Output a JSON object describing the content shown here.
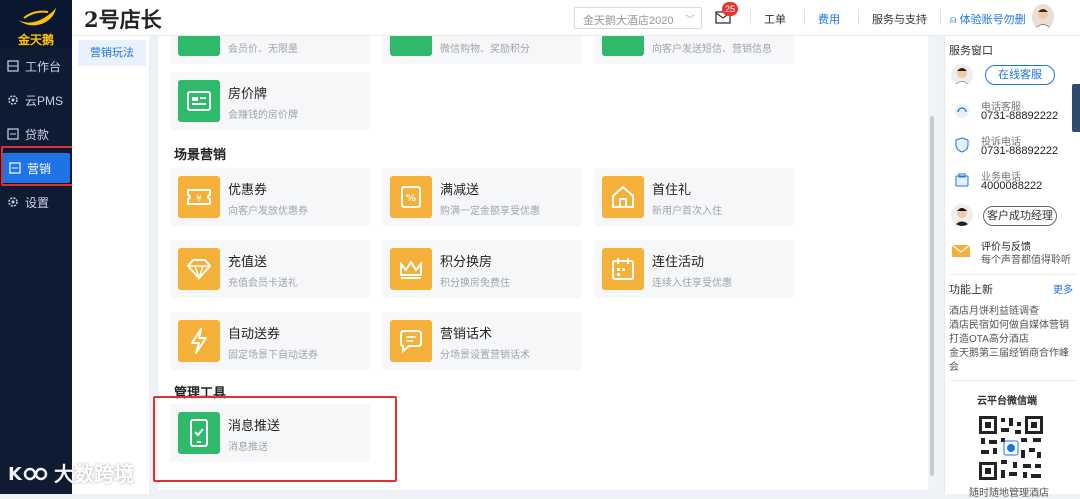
{
  "app": {
    "title": "2号店长",
    "brand": "金天鹅"
  },
  "left_nav": {
    "items": [
      {
        "label": "工作台",
        "icon": "workbench-icon"
      },
      {
        "label": "云PMS",
        "icon": "gear-icon"
      },
      {
        "label": "贷款",
        "icon": "loan-icon"
      },
      {
        "label": "营销",
        "icon": "marketing-icon",
        "active": true
      },
      {
        "label": "设置",
        "icon": "settings-icon"
      }
    ]
  },
  "header": {
    "hotel_select": "金天鹅大酒店2020",
    "mail_badge": "25",
    "links": [
      "工单",
      "费用",
      "服务与支持",
      "体验账号勿删"
    ]
  },
  "sub_nav": {
    "item": "营销玩法"
  },
  "main": {
    "top_partial_descs": [
      "会员价、无限量",
      "微信购物、奖励积分",
      "向客户发送短信、营销信息"
    ],
    "card_room_price": {
      "title": "房价牌",
      "desc": "会赚钱的房价牌"
    },
    "section_scene": "场景营销",
    "scene_cards": [
      {
        "title": "优惠券",
        "desc": "向客户发放优惠券",
        "icon": "coupon-icon"
      },
      {
        "title": "满减送",
        "desc": "购满一定金额享受优惠",
        "icon": "percent-discount-icon"
      },
      {
        "title": "首住礼",
        "desc": "新用户首次入住",
        "icon": "house-gift-icon"
      },
      {
        "title": "充值送",
        "desc": "充值会员卡送礼",
        "icon": "diamond-icon"
      },
      {
        "title": "积分换房",
        "desc": "积分换房免费住",
        "icon": "crown-icon"
      },
      {
        "title": "连住活动",
        "desc": "连续入住享受优惠",
        "icon": "calendar-icon"
      },
      {
        "title": "自动送券",
        "desc": "固定场景下自动送券",
        "icon": "lightning-icon"
      },
      {
        "title": "营销话术",
        "desc": "分场景设置营销话术",
        "icon": "chat-bubble-icon"
      }
    ],
    "section_mgmt": "管理工具",
    "mgmt_card": {
      "title": "消息推送",
      "desc": "消息推送",
      "icon": "phone-check-icon"
    }
  },
  "right_panel": {
    "service_title": "服务窗口",
    "online_service": "在线客服",
    "phone_label": "电话客服",
    "phone_value": "0731-88892222",
    "complaint_label": "投诉电话",
    "complaint_value": "0731-88892222",
    "business_label": "业务电话",
    "business_value": "4000088222",
    "success_manager": "客户成功经理",
    "feedback_title": "评价与反馈",
    "feedback_desc": "每个声音都值得聆听",
    "news_title": "功能上新",
    "news_more": "更多",
    "news": [
      "酒店月饼利益链调查",
      "酒店民宿如何做自媒体营销",
      "打造OTA高分酒店",
      "金天鹅第三届经销商合作峰",
      "会"
    ],
    "wechat_title": "云平台微信端",
    "wechat_desc": "随时随地管理酒店"
  },
  "watermark": "大数跨境",
  "colors": {
    "nav_bg": "#0e1b33",
    "accent": "#1e74e6",
    "green": "#2fb96a",
    "amber": "#f5b03a",
    "highlight": "#e03030"
  }
}
